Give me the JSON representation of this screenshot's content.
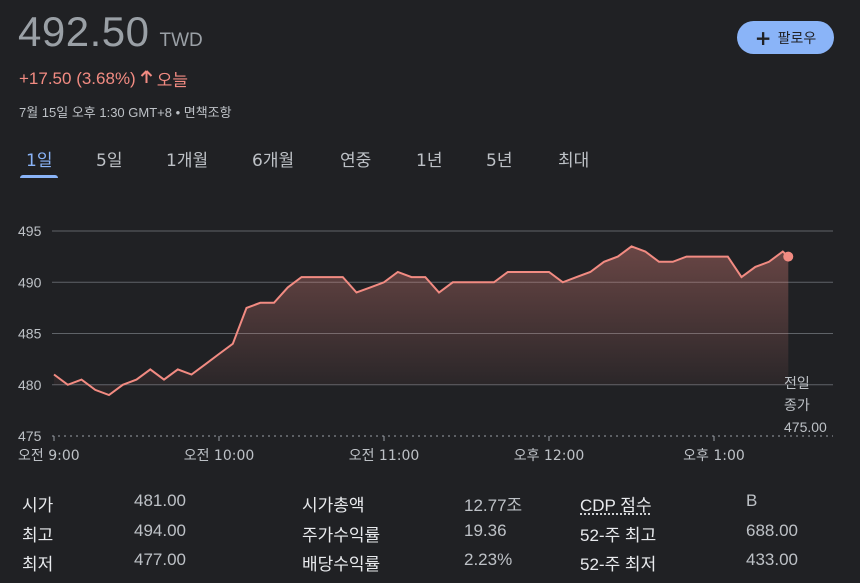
{
  "quote": {
    "price": "492.50",
    "currency": "TWD",
    "change": "+17.50 (3.68%)",
    "change_period": "오늘",
    "timestamp": "7월 15일 오후 1:30 GMT+8 • 면책조항",
    "follow_label": "팔로우"
  },
  "tabs": [
    "1일",
    "5일",
    "1개월",
    "6개월",
    "연중",
    "1년",
    "5년",
    "최대"
  ],
  "active_tab": 0,
  "colors": {
    "line": "#f28b82",
    "accent": "#8ab4f8"
  },
  "chart_data": {
    "type": "area",
    "ylim": [
      475,
      495
    ],
    "yticks": [
      475,
      480,
      485,
      490,
      495
    ],
    "xticks": [
      "오전 9:00",
      "오전 10:00",
      "오전 11:00",
      "오후 12:00",
      "오후 1:00"
    ],
    "x_range_minutes": [
      0,
      270
    ],
    "x": [
      0,
      5,
      10,
      15,
      20,
      25,
      30,
      35,
      40,
      45,
      50,
      55,
      60,
      65,
      70,
      75,
      80,
      85,
      90,
      95,
      100,
      105,
      110,
      115,
      120,
      125,
      130,
      135,
      140,
      145,
      150,
      155,
      160,
      165,
      170,
      175,
      180,
      185,
      190,
      195,
      200,
      205,
      210,
      215,
      220,
      225,
      230,
      235,
      240,
      245,
      250,
      255,
      260,
      265
    ],
    "values": [
      481,
      480,
      480.5,
      479.5,
      479,
      480,
      480.5,
      481.5,
      480.5,
      481.5,
      481,
      482,
      483,
      484,
      487.5,
      488,
      488,
      489.5,
      490.5,
      490.5,
      490.5,
      490.5,
      489,
      489.5,
      490,
      491,
      490.5,
      490.5,
      489,
      490,
      490,
      490,
      490,
      491,
      491,
      491,
      491,
      490,
      490.5,
      491,
      492,
      492.5,
      493.5,
      493,
      492,
      492,
      492.5,
      492.5,
      492.5,
      492.5,
      490.5,
      491.5,
      492,
      493
    ],
    "last": {
      "x": 267,
      "y": 492.5
    },
    "previous_close": {
      "label_line1": "전일",
      "label_line2": "종가",
      "value": "475.00",
      "y": 475
    }
  },
  "stats": [
    {
      "label": "시가",
      "value": "481.00"
    },
    {
      "label": "최고",
      "value": "494.00"
    },
    {
      "label": "최저",
      "value": "477.00"
    },
    {
      "label": "시가총액",
      "value": "12.77조"
    },
    {
      "label": "주가수익률",
      "value": "19.36"
    },
    {
      "label": "배당수익률",
      "value": "2.23%"
    },
    {
      "label": "CDP 점수",
      "value": "B"
    },
    {
      "label": "52-주 최고",
      "value": "688.00"
    },
    {
      "label": "52-주 최저",
      "value": "433.00"
    }
  ]
}
